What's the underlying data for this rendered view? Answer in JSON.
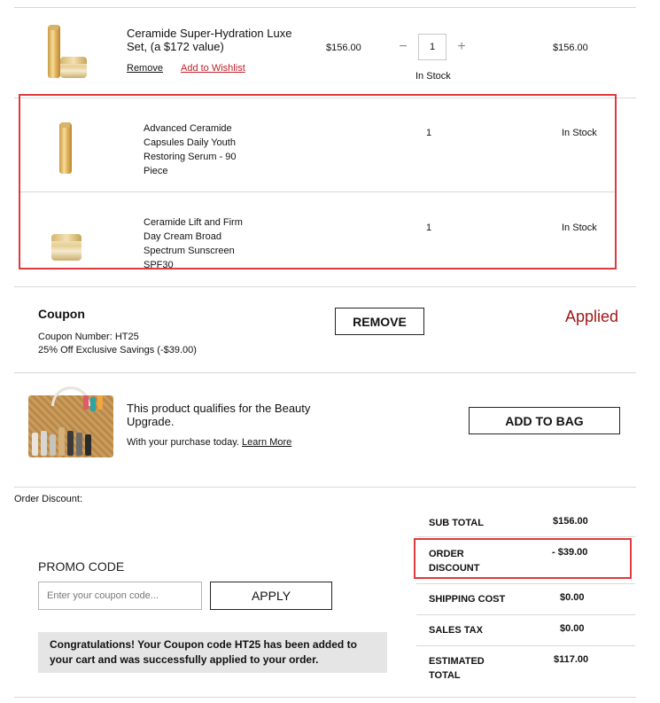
{
  "item": {
    "name": "Ceramide Super-Hydration Luxe Set, (a $172 value)",
    "price": "$156.00",
    "quantity": "1",
    "stock": "In Stock",
    "line_total": "$156.00",
    "remove_label": "Remove",
    "wishlist_label": "Add to Wishlist",
    "components": [
      {
        "name": "Advanced Ceramide Capsules Daily Youth Restoring Serum - 90 Piece",
        "quantity": "1",
        "stock": "In Stock"
      },
      {
        "name": "Ceramide Lift and Firm Day Cream Broad Spectrum Sunscreen SPF30",
        "quantity": "1",
        "stock": "In Stock"
      }
    ]
  },
  "coupon": {
    "heading": "Coupon",
    "number_line": "Coupon Number: HT25",
    "savings_line": "25% Off Exclusive Savings (-$39.00)",
    "remove_label": "REMOVE",
    "status": "Applied",
    "status_color": "#a01818"
  },
  "upgrade": {
    "text": "This product qualifies for the Beauty Upgrade.",
    "subtext": "With your purchase today.",
    "learn_more": "Learn More",
    "button": "ADD TO BAG"
  },
  "order_discount_label": "Order Discount:",
  "promo": {
    "heading": "PROMO CODE",
    "placeholder": "Enter your coupon code...",
    "apply_label": "APPLY",
    "message": "Congratulations! Your Coupon code HT25 has been added to your cart and was successfully applied to your order."
  },
  "totals": {
    "subtotal_label": "SUB TOTAL",
    "subtotal": "$156.00",
    "discount_label": "ORDER DISCOUNT",
    "discount": "- $39.00",
    "shipping_label": "SHIPPING COST",
    "shipping": "$0.00",
    "tax_label": "SALES TAX",
    "tax": "$0.00",
    "estimated_label": "ESTIMATED TOTAL",
    "estimated": "$117.00"
  },
  "highlight_color": "#e0393e"
}
